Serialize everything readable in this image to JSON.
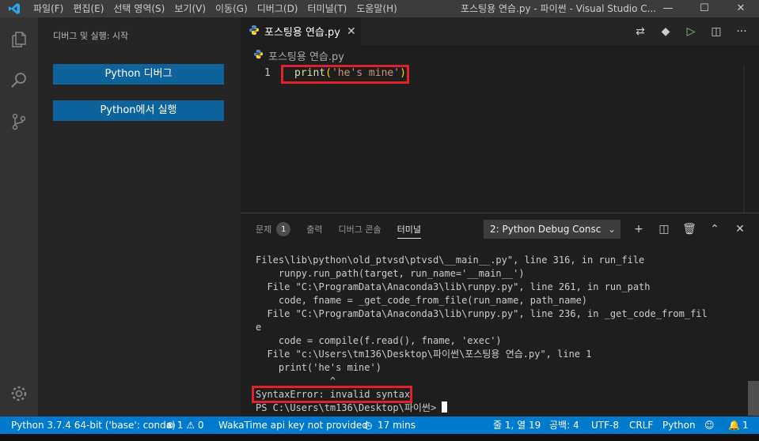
{
  "titlebar": {
    "menu": [
      "파일(F)",
      "편집(E)",
      "선택 영역(S)",
      "보기(V)",
      "이동(G)",
      "디버그(D)",
      "터미널(T)",
      "도움말(H)"
    ],
    "window_title": "포스팅용 연습.py - 파이썬 - Visual Studio C...",
    "minimize": "—",
    "maximize": "☐",
    "close": "✕"
  },
  "sidebar": {
    "title": "디버그 및 실행: 시작",
    "debug_button": "Python 디버그",
    "run_button": "Python에서 실행"
  },
  "editor": {
    "tab_label": "포스팅용 연습.py",
    "tab_close": "✕",
    "breadcrumb": "포스팅용 연습.py",
    "line_number": "1",
    "code": {
      "func": "print",
      "open": "(",
      "string": "'he's mine'",
      "close": ")"
    }
  },
  "panel": {
    "tabs": {
      "problems": "문제",
      "problems_count": "1",
      "output": "출력",
      "debug_console": "디버그 콘솔",
      "terminal": "터미널"
    },
    "terminal_select": "2: Python Debug Consc",
    "terminal_lines": [
      "Files\\lib\\python\\old_ptvsd\\ptvsd\\__main__.py\", line 316, in run_file",
      "    runpy.run_path(target, run_name='__main__')",
      "  File \"C:\\ProgramData\\Anaconda3\\lib\\runpy.py\", line 261, in run_path",
      "    code, fname = _get_code_from_file(run_name, path_name)",
      "  File \"C:\\ProgramData\\Anaconda3\\lib\\runpy.py\", line 236, in _get_code_from_fil",
      "e",
      "    code = compile(f.read(), fname, 'exec')",
      "  File \"c:\\Users\\tm136\\Desktop\\파이썬\\포스팅용 연습.py\", line 1",
      "    print('he's mine')",
      "             ^",
      "SyntaxError: invalid syntax"
    ],
    "prompt": "PS C:\\Users\\tm136\\Desktop\\파이썬> "
  },
  "statusbar": {
    "interpreter": "Python 3.7.4 64-bit ('base': conda)",
    "problems": "⊗ 1 ⚠ 0",
    "wakatime": "WakaTime api key not provided",
    "time": "17 mins",
    "position": "줄 1, 열 19",
    "spaces": "공백: 4",
    "encoding": "UTF-8",
    "eol": "CRLF",
    "language": "Python",
    "notifications": "1"
  },
  "colors": {
    "accent": "#007acc",
    "button": "#0e639c",
    "highlight_box": "#e0202a",
    "string": "#ce9178",
    "function": "#dcdcaa"
  }
}
